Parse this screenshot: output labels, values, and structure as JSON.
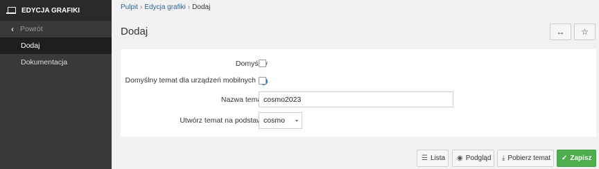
{
  "sidebar": {
    "title": "EDYCJA GRAFIKI",
    "items": [
      {
        "label": "Powrót"
      },
      {
        "label": "Dodaj"
      },
      {
        "label": "Dokumentacja"
      }
    ]
  },
  "breadcrumb": {
    "items": [
      "Pulpit",
      "Edycja grafiki",
      "Dodaj"
    ],
    "separator": "›"
  },
  "page": {
    "title": "Dodaj",
    "expand_icon": "↔",
    "star_icon": "☆"
  },
  "form": {
    "default_label": "Domyślny",
    "default_checked": false,
    "mobile_label": "Domyślny temat dla urządzeń mobilnych",
    "mobile_checked": false,
    "info_icon": "i",
    "name_label": "Nazwa tematu",
    "name_value": "cosmo2023",
    "base_label": "Utwórz temat na podstawie",
    "base_value": "cosmo"
  },
  "actions": {
    "list_label": "Lista",
    "preview_label": "Podgląd",
    "download_label": "Pobierz temat",
    "save_label": "Zapisz"
  },
  "colors": {
    "sidebar_bg": "#393939",
    "sidebar_active": "#1e1e1e",
    "link": "#2a6496",
    "save_green": "#4cae4c",
    "info_blue": "#2a7ad0"
  }
}
